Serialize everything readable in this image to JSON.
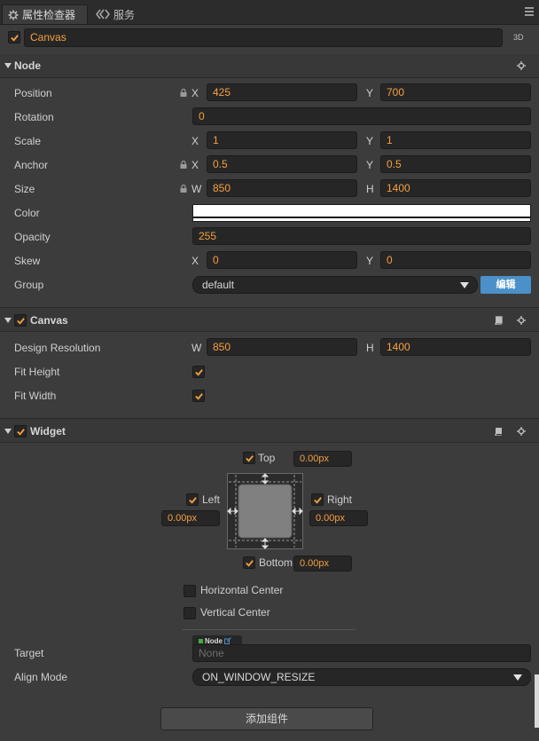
{
  "tabs": [
    {
      "label": "属性检查器",
      "icon": "gear-icon"
    },
    {
      "label": "服务",
      "icon": "service-icon"
    }
  ],
  "node_header": {
    "enabled": true,
    "name": "Canvas",
    "badge": "3D"
  },
  "node": {
    "title": "Node",
    "position": {
      "label": "Position",
      "x_label": "X",
      "x": "425",
      "y_label": "Y",
      "y": "700"
    },
    "rotation": {
      "label": "Rotation",
      "value": "0"
    },
    "scale": {
      "label": "Scale",
      "x_label": "X",
      "x": "1",
      "y_label": "Y",
      "y": "1"
    },
    "anchor": {
      "label": "Anchor",
      "x_label": "X",
      "x": "0.5",
      "y_label": "Y",
      "y": "0.5"
    },
    "size": {
      "label": "Size",
      "w_label": "W",
      "w": "850",
      "h_label": "H",
      "h": "1400"
    },
    "color": {
      "label": "Color",
      "value": "#ffffff"
    },
    "opacity": {
      "label": "Opacity",
      "value": "255"
    },
    "skew": {
      "label": "Skew",
      "x_label": "X",
      "x": "0",
      "y_label": "Y",
      "y": "0"
    },
    "group": {
      "label": "Group",
      "value": "default",
      "edit_button": "编辑"
    }
  },
  "canvas": {
    "title": "Canvas",
    "enabled": true,
    "design_resolution": {
      "label": "Design Resolution",
      "w_label": "W",
      "w": "850",
      "h_label": "H",
      "h": "1400"
    },
    "fit_height": {
      "label": "Fit Height",
      "checked": true
    },
    "fit_width": {
      "label": "Fit Width",
      "checked": true
    }
  },
  "widget": {
    "title": "Widget",
    "enabled": true,
    "top": {
      "label": "Top",
      "checked": true,
      "value": "0.00px"
    },
    "left": {
      "label": "Left",
      "checked": true,
      "value": "0.00px"
    },
    "right": {
      "label": "Right",
      "checked": true,
      "value": "0.00px"
    },
    "bottom": {
      "label": "Bottom",
      "checked": true,
      "value": "0.00px"
    },
    "horizontal_center": {
      "label": "Horizontal Center",
      "checked": false
    },
    "vertical_center": {
      "label": "Vertical Center",
      "checked": false
    },
    "target": {
      "label": "Target",
      "type_tag": "Node",
      "placeholder": "None"
    },
    "align_mode": {
      "label": "Align Mode",
      "value": "ON_WINDOW_RESIZE"
    }
  },
  "add_component_button": "添加组件",
  "colors": {
    "accent": "#f6a040",
    "edit_button": "#4b90c8",
    "panel": "#3c3c3c",
    "field": "#262626"
  }
}
